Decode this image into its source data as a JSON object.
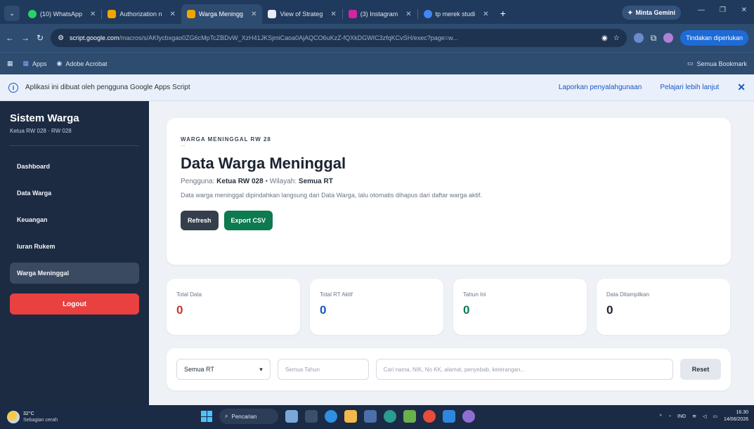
{
  "browser": {
    "tab_menu_icon": "chevron-down-icon",
    "tabs": [
      {
        "label": "(10) WhatsApp",
        "color": "#25d366",
        "active": false
      },
      {
        "label": "Authorization n",
        "color": "#f0a500",
        "active": false
      },
      {
        "label": "Warga Meningg",
        "color": "#f0a500",
        "active": true
      },
      {
        "label": "View of Strateg",
        "color": "#ffffff",
        "active": false
      },
      {
        "label": "(3) Instagram",
        "color": "#d6249f",
        "active": false
      },
      {
        "label": "tp merek studi",
        "color": "#4285f4",
        "active": false
      }
    ],
    "new_tab": "+",
    "gemini_label": "Minta Gemini",
    "url_host": "script.google.com",
    "url_path": "/macros/s/AKfycbxgao0ZG6cMpTcZBDvW_XzH41JKSjmiCaoa0AjAQCO6uKzZ-fQXkDGWIC3zfqKCvSH/exec?page=w...",
    "action_button": "Tindakan diperlukan",
    "bookmarks": [
      {
        "label": "Apps"
      },
      {
        "label": "Adobe Acrobat"
      }
    ],
    "all_bookmarks": "Semua Bookmark"
  },
  "infobar": {
    "message": "Aplikasi ini dibuat oleh pengguna Google Apps Script",
    "report_link": "Laporkan penyalahgunaan",
    "learn_link": "Pelajari lebih lanjut",
    "close": "✕"
  },
  "sidebar": {
    "title": "Sistem Warga",
    "subtitle": "Ketua RW 028 · RW 028",
    "items": [
      {
        "label": "Dashboard",
        "active": false
      },
      {
        "label": "Data Warga",
        "active": false
      },
      {
        "label": "Keuangan",
        "active": false
      },
      {
        "label": "Iuran Rukem",
        "active": false
      },
      {
        "label": "Warga Meninggal",
        "active": true
      }
    ],
    "logout": "Logout"
  },
  "hero": {
    "eyebrow": "WARGA MENINGGAL RW 28",
    "eyebrow_dots": "...",
    "title": "Data Warga Meninggal",
    "user_label": "Pengguna:",
    "user_value": "Ketua RW 028",
    "sep": "•",
    "area_label": "Wilayah:",
    "area_value": "Semua RT",
    "description": "Data warga meninggal dipindahkan langsung dari Data Warga, lalu otomatis dihapus dari daftar warga aktif.",
    "refresh": "Refresh",
    "export": "Export CSV"
  },
  "stats": [
    {
      "label": "Total Data",
      "value": "0",
      "color": "#c0392b"
    },
    {
      "label": "Total RT Aktif",
      "value": "0",
      "color": "#1a55c5"
    },
    {
      "label": "Tahun Ini",
      "value": "0",
      "color": "#0d7a4f"
    },
    {
      "label": "Data Ditampilkan",
      "value": "0",
      "color": "#1b2230"
    }
  ],
  "filters": {
    "rt_select": "Semua RT",
    "year_placeholder": "Semua Tahun",
    "search_placeholder": "Cari nama, NIK, No KK, alamat, penyebab, keterangan...",
    "reset": "Reset"
  },
  "taskbar": {
    "temperature": "32°C",
    "weather": "Sebagian cerah",
    "search": "Pencarian",
    "lang": "IND",
    "time": "16.30",
    "date": "14/06/2026"
  }
}
